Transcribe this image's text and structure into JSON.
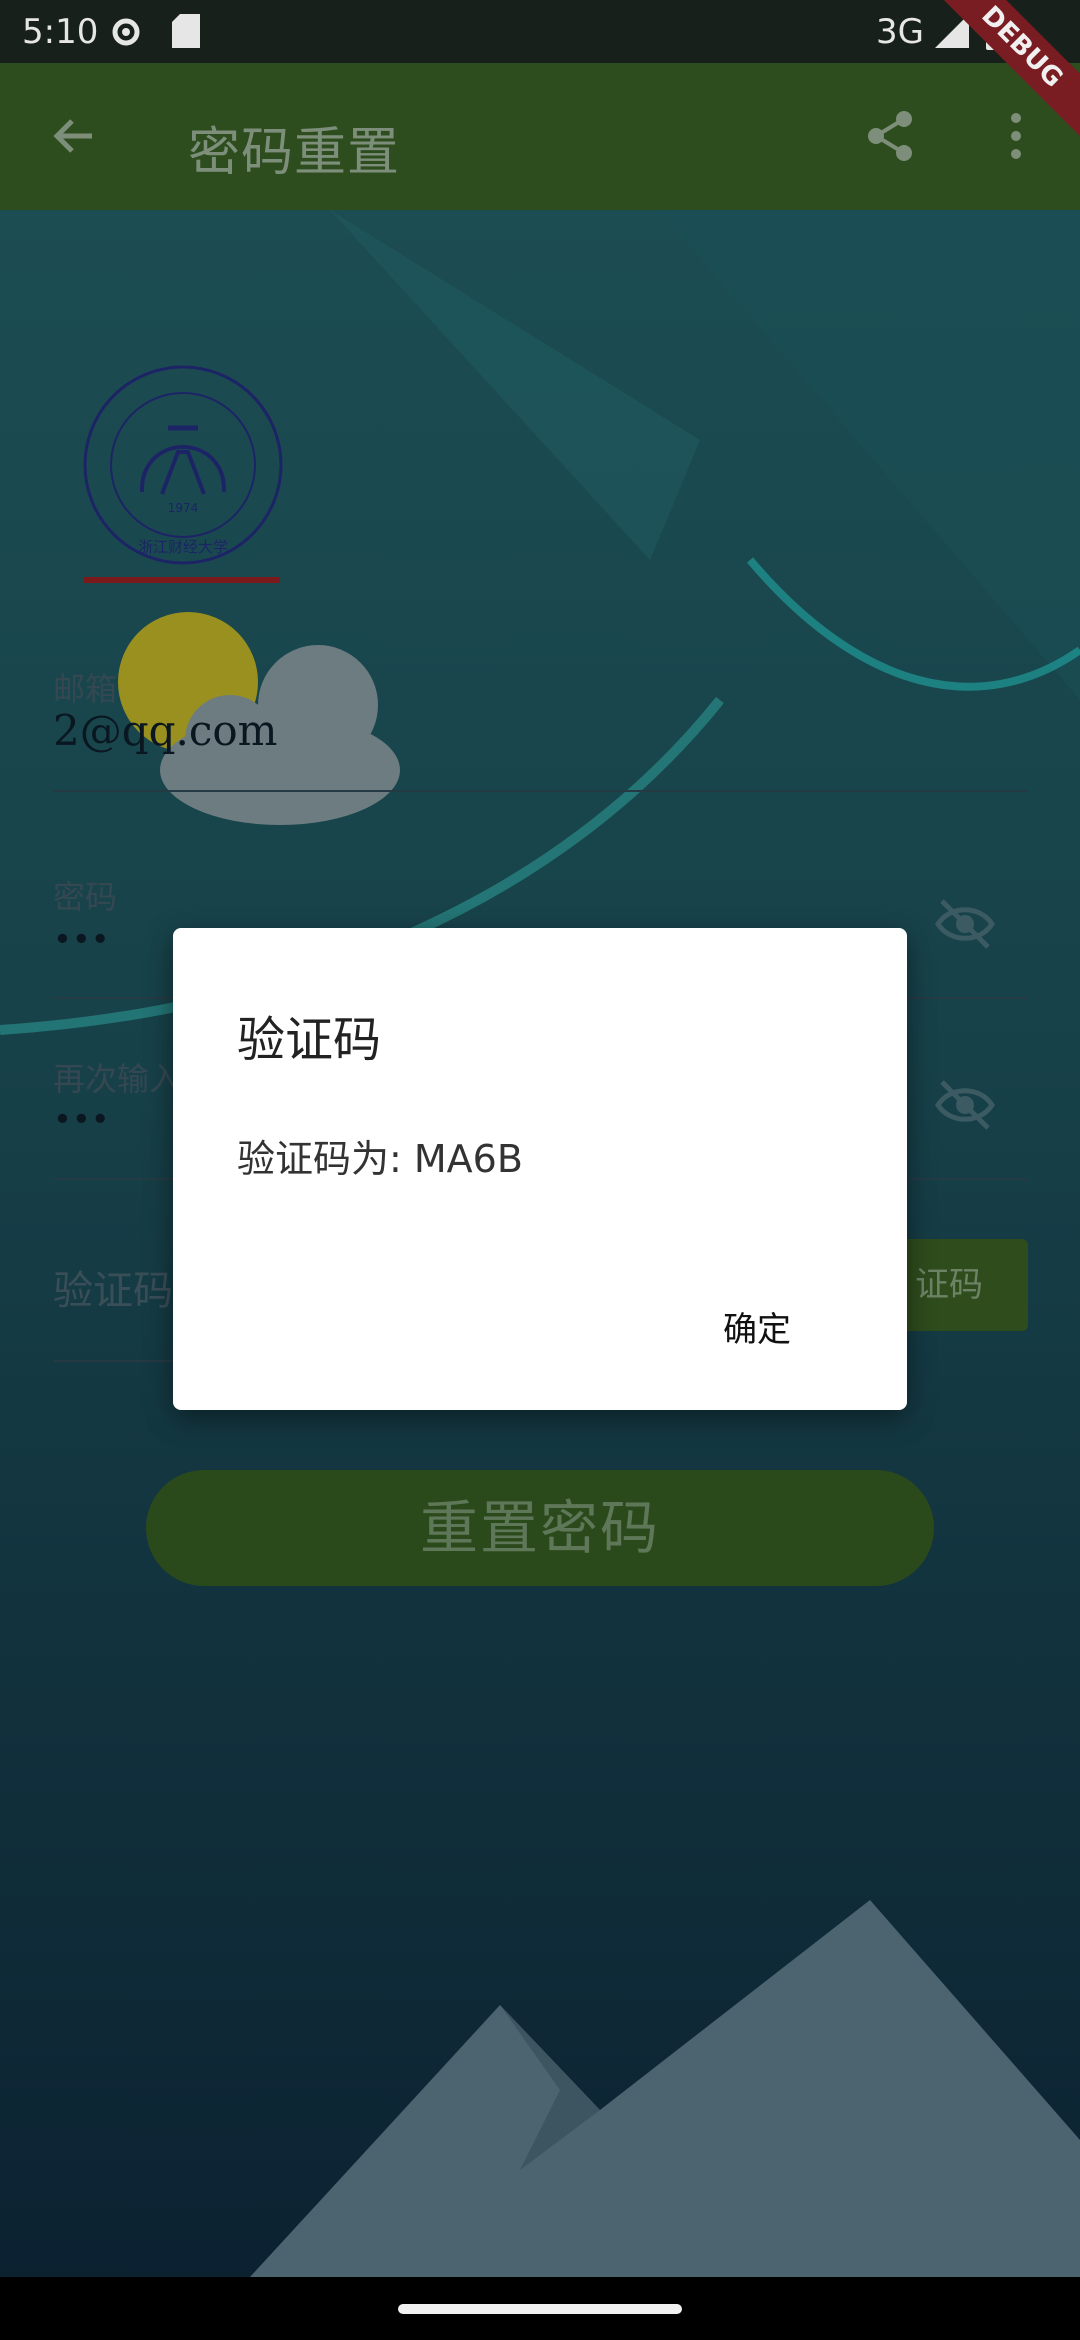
{
  "status_bar": {
    "time": "5:10",
    "network": "3G",
    "debug_banner": "DEBUG"
  },
  "app_bar": {
    "title": "密码重置"
  },
  "form": {
    "email": {
      "label": "邮箱",
      "value": "2@qq.com"
    },
    "password": {
      "label": "密码",
      "value": "•••"
    },
    "confirm_password": {
      "label": "再次输入",
      "value": "•••"
    },
    "verification": {
      "placeholder": "验证码",
      "send_button_visible_text": "证码"
    },
    "reset_button": "重置密码"
  },
  "logo": {
    "text": "浙江财经大学",
    "year": "1974"
  },
  "dialog": {
    "title": "验证码",
    "message": "验证码为: MA6B",
    "ok_label": "确定"
  },
  "colors": {
    "app_bar": "#2e4d1e",
    "button": "#2b4a1b",
    "dialog_bg": "#ffffff"
  }
}
